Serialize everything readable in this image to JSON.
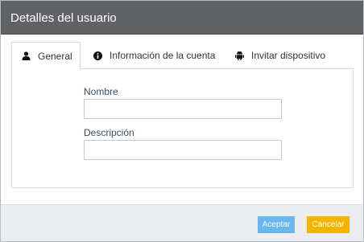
{
  "dialog": {
    "title": "Detalles del usuario"
  },
  "tabs": [
    {
      "label": "General",
      "icon": "user-icon",
      "active": true
    },
    {
      "label": "Información de la cuenta",
      "icon": "info-circle-icon",
      "active": false
    },
    {
      "label": "Invitar dispositivo",
      "icon": "android-icon",
      "active": false
    }
  ],
  "form": {
    "name_label": "Nombre",
    "name_value": "",
    "description_label": "Descripción",
    "description_value": ""
  },
  "footer": {
    "accept_label": "Aceptar",
    "cancel_label": "Cancelar"
  },
  "colors": {
    "header_bg": "#606266",
    "accept_bg": "#5ab3ee",
    "cancel_bg": "#f5b400",
    "label_color": "#2f4f6b"
  }
}
